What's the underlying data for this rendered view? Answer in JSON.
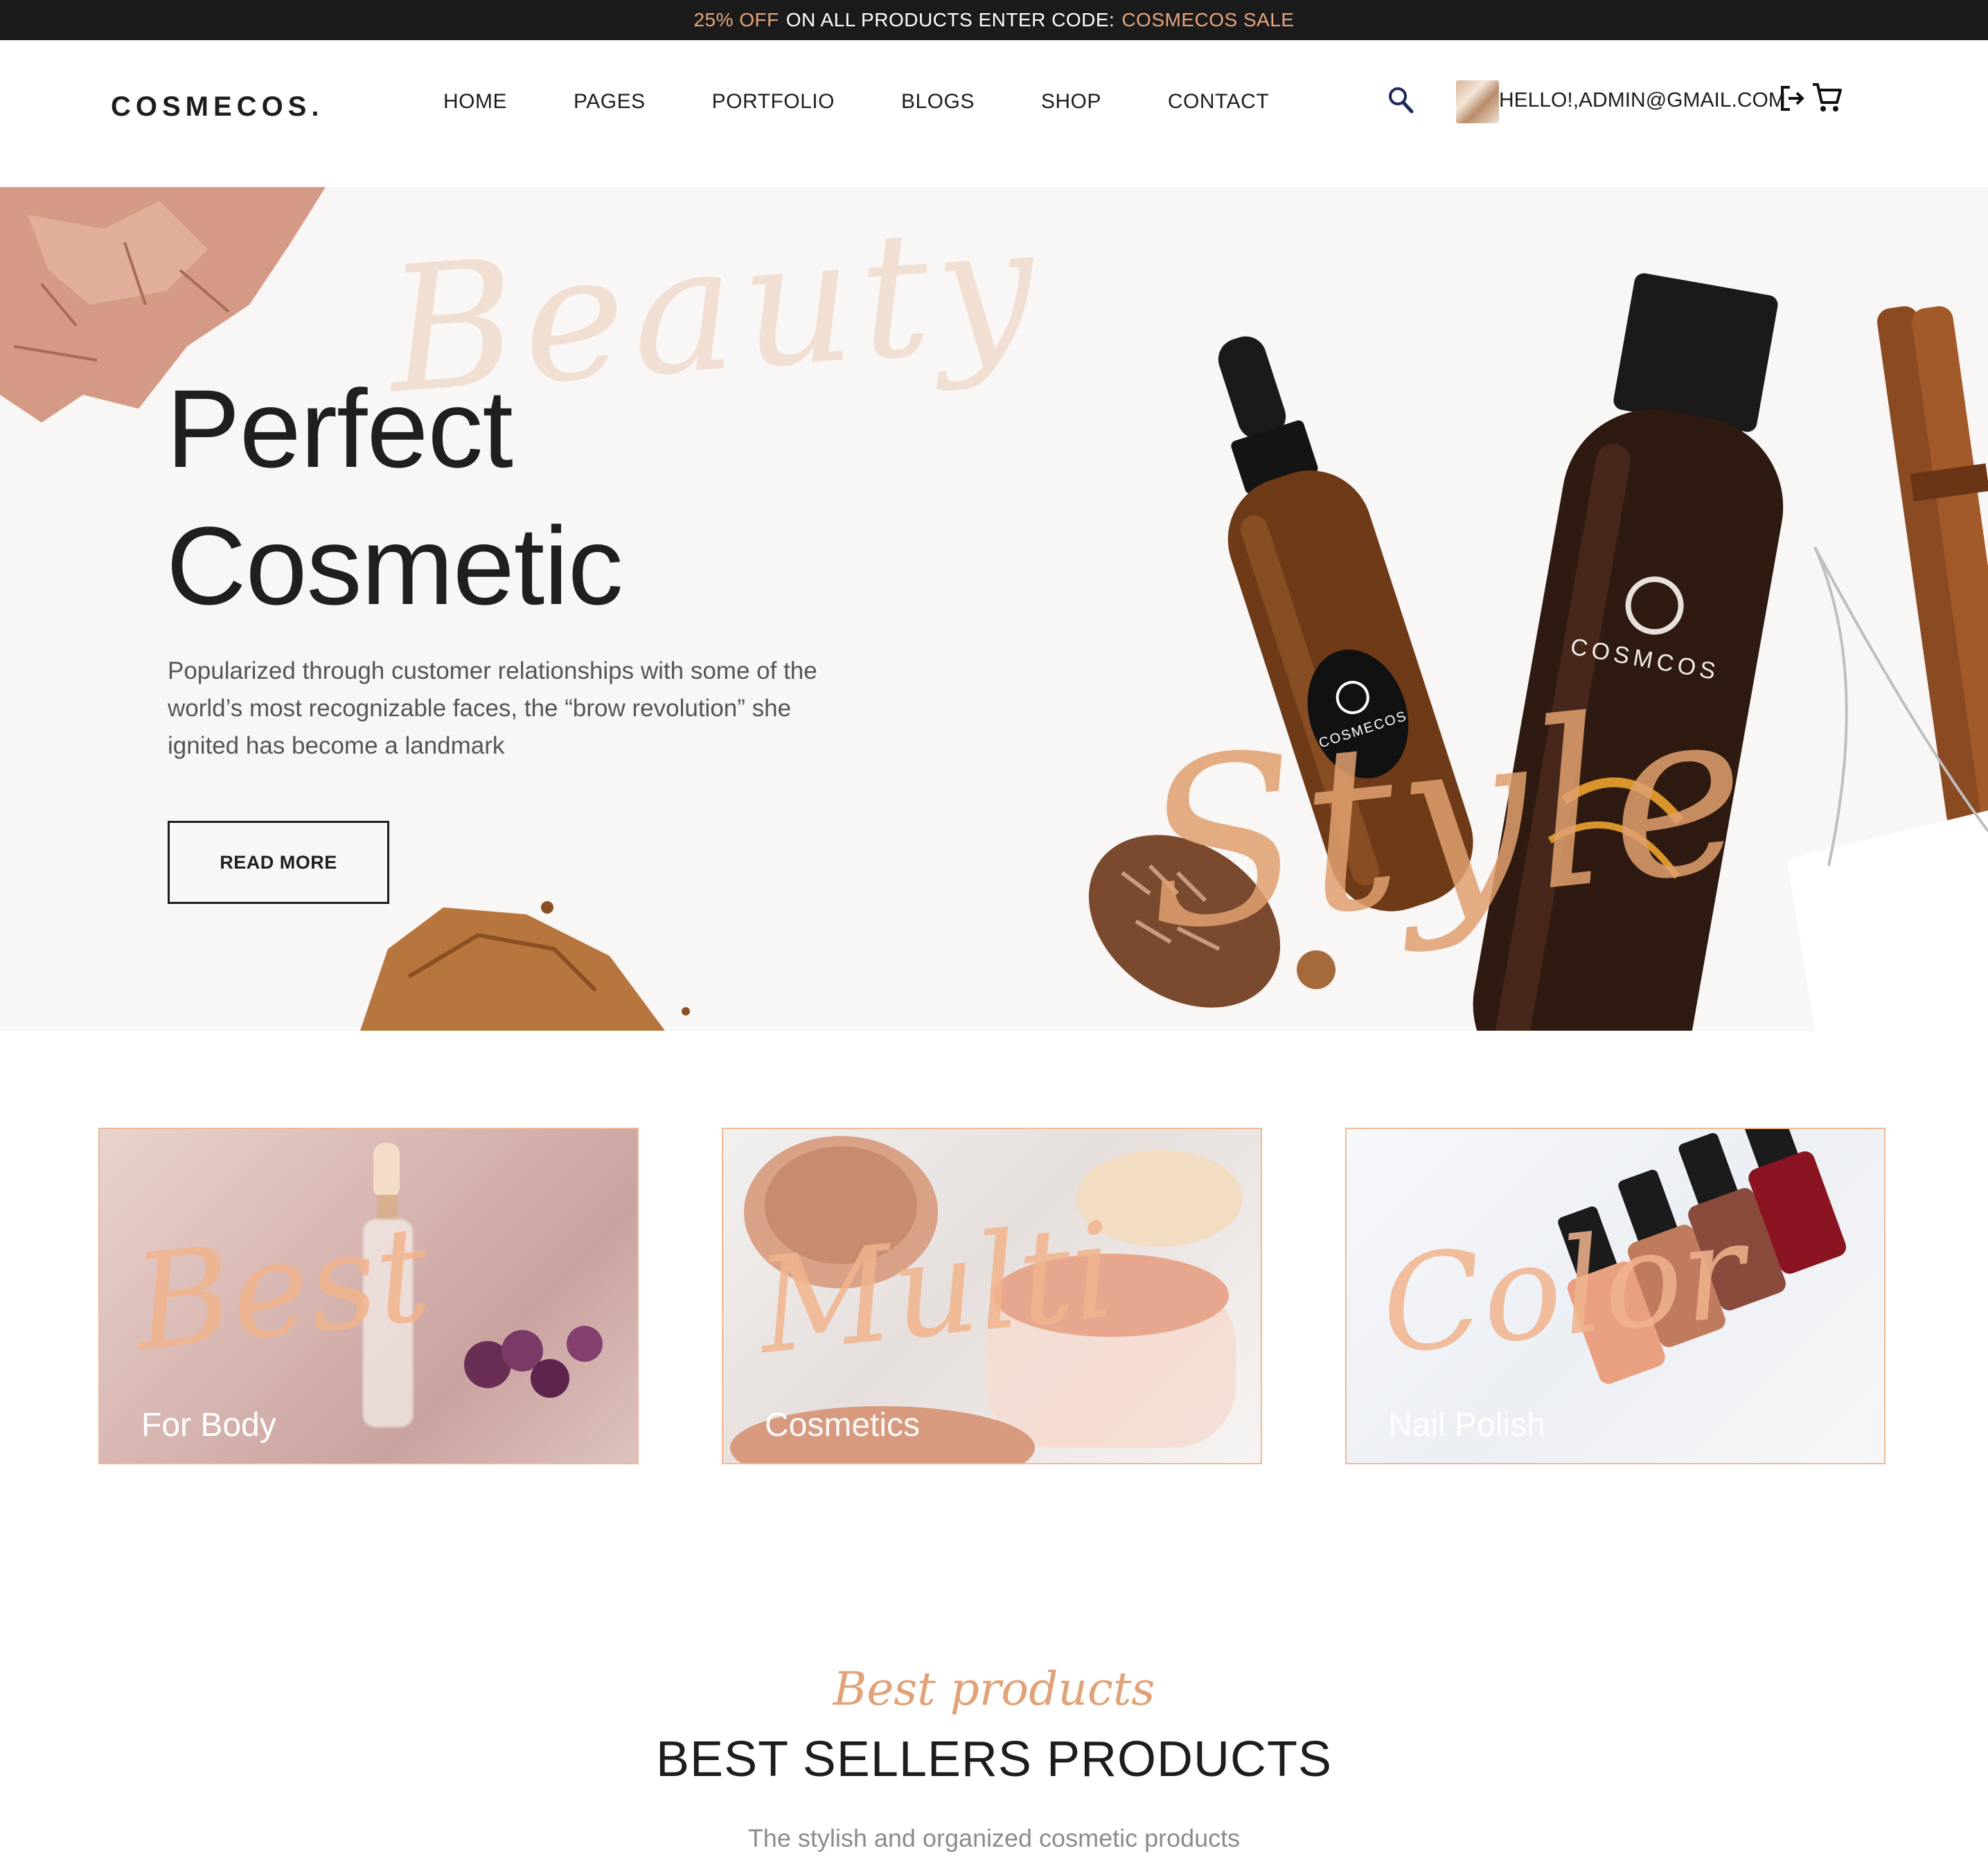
{
  "promo": {
    "discount": "25% OFF",
    "middle": "ON ALL PRODUCTS ENTER CODE:",
    "code": "COSMECOS SALE"
  },
  "header": {
    "logo": "COSMECOS.",
    "nav": [
      "HOME",
      "PAGES",
      "PORTFOLIO",
      "BLOGS",
      "SHOP",
      "CONTACT"
    ],
    "user_email": "HELLO!,ADMIN@GMAIL.COM"
  },
  "hero": {
    "script_word": "Beauty",
    "title_line1": "Perfect",
    "title_line2": "Cosmetic",
    "description": "Popularized through customer relationships with some of the world’s most recognizable faces, the “brow revolution” she ignited has become a landmark",
    "cta": "READ MORE",
    "accent_script": "Style",
    "small_bottle_label": "COSMECOS",
    "large_bottle_label": "COSMCOS"
  },
  "categories": [
    {
      "script": "Best",
      "label": "For Body"
    },
    {
      "script": "Multi",
      "label": "Cosmetics"
    },
    {
      "script": "Color",
      "label": "Nail Polish"
    }
  ],
  "best_sellers": {
    "eyebrow": "Best products",
    "heading": "BEST SELLERS PRODUCTS",
    "subtitle": "The stylish and organized cosmetic products"
  },
  "colors": {
    "accent": "#e8a47c",
    "dark": "#1b1b1b",
    "hero_bg": "#f8f7f5"
  },
  "icons": [
    "search-icon",
    "logout-icon",
    "cart-icon"
  ]
}
